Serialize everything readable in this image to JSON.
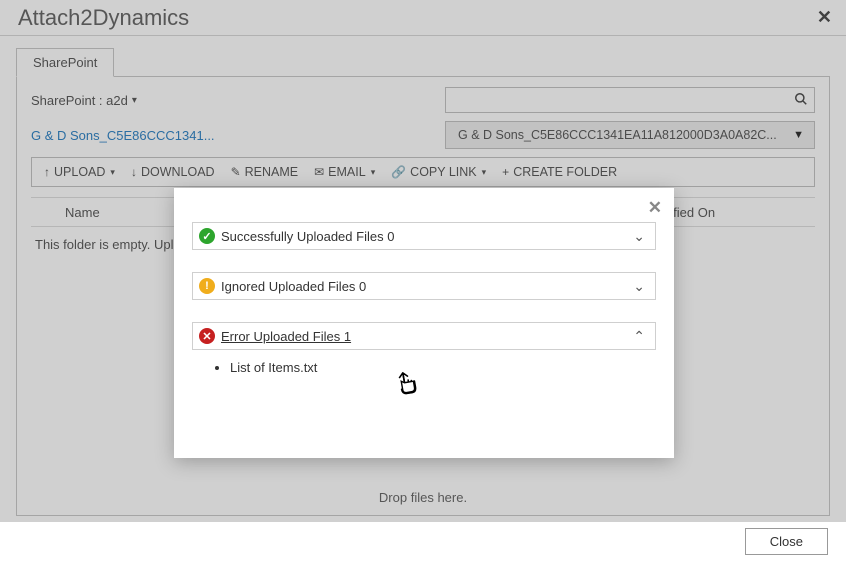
{
  "app": {
    "title": "Attach2Dynamics"
  },
  "tab": {
    "label": "SharePoint"
  },
  "sp": {
    "label": "SharePoint : a2d",
    "breadcrumb": "G & D Sons_C5E86CCC1341...",
    "path_display": "G & D Sons_C5E86CCC1341EA11A812000D3A0A82C..."
  },
  "toolbar": {
    "upload": "UPLOAD",
    "download": "DOWNLOAD",
    "rename": "RENAME",
    "email": "EMAIL",
    "copylink": "COPY LINK",
    "create_folder": "CREATE FOLDER"
  },
  "grid": {
    "col_name": "Name",
    "col_modified": "Modified On",
    "empty": "This folder is empty. Uplo"
  },
  "drop_hint": "Drop files here.",
  "footer": {
    "close": "Close"
  },
  "modal": {
    "success_label": "Successfully Uploaded Files 0",
    "ignored_label": "Ignored Uploaded Files 0",
    "error_label": " Error Uploaded Files 1",
    "error_files": [
      "List of Items.txt"
    ]
  }
}
